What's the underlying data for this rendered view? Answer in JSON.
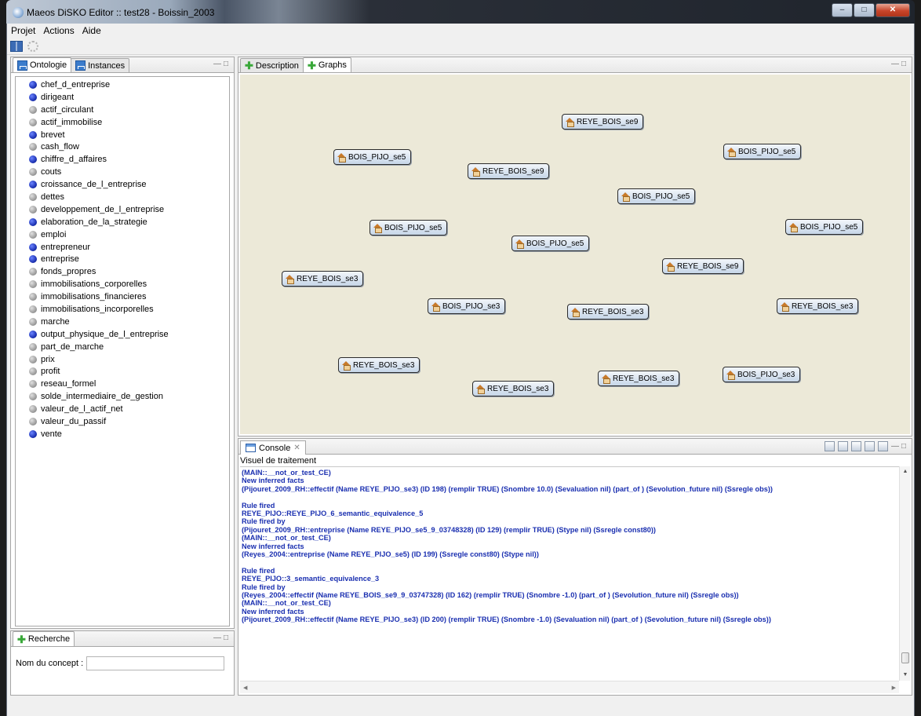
{
  "window": {
    "title": "Maeos DiSKO Editor :: test28 - Boissin_2003",
    "controls": [
      "minimize",
      "maximize",
      "close"
    ]
  },
  "menu": [
    "Projet",
    "Actions",
    "Aide"
  ],
  "toolbar": {
    "icons": [
      "book-icon",
      "spinner-icon"
    ]
  },
  "left_panel": {
    "tabs": [
      "Ontologie",
      "Instances"
    ],
    "concepts": [
      {
        "label": "chef_d_entreprise",
        "color": "blue"
      },
      {
        "label": "dirigeant",
        "color": "blue"
      },
      {
        "label": "actif_circulant",
        "color": "gray"
      },
      {
        "label": "actif_immobilise",
        "color": "gray"
      },
      {
        "label": "brevet",
        "color": "blue"
      },
      {
        "label": "cash_flow",
        "color": "gray"
      },
      {
        "label": "chiffre_d_affaires",
        "color": "blue"
      },
      {
        "label": "couts",
        "color": "gray"
      },
      {
        "label": "croissance_de_l_entreprise",
        "color": "blue"
      },
      {
        "label": "dettes",
        "color": "gray"
      },
      {
        "label": "developpement_de_l_entreprise",
        "color": "gray"
      },
      {
        "label": "elaboration_de_la_strategie",
        "color": "blue"
      },
      {
        "label": "emploi",
        "color": "gray"
      },
      {
        "label": "entrepreneur",
        "color": "blue"
      },
      {
        "label": "entreprise",
        "color": "blue"
      },
      {
        "label": "fonds_propres",
        "color": "gray"
      },
      {
        "label": "immobilisations_corporelles",
        "color": "gray"
      },
      {
        "label": "immobilisations_financieres",
        "color": "gray"
      },
      {
        "label": "immobilisations_incorporelles",
        "color": "gray"
      },
      {
        "label": "marche",
        "color": "gray"
      },
      {
        "label": "output_physique_de_l_entreprise",
        "color": "blue"
      },
      {
        "label": "part_de_marche",
        "color": "gray"
      },
      {
        "label": "prix",
        "color": "gray"
      },
      {
        "label": "profit",
        "color": "gray"
      },
      {
        "label": "reseau_formel",
        "color": "gray"
      },
      {
        "label": "solde_intermediaire_de_gestion",
        "color": "gray"
      },
      {
        "label": "valeur_de_l_actif_net",
        "color": "gray"
      },
      {
        "label": "valeur_du_passif",
        "color": "gray"
      },
      {
        "label": "vente",
        "color": "blue"
      }
    ]
  },
  "search_panel": {
    "tab": "Recherche",
    "label": "Nom du concept :",
    "value": ""
  },
  "graph_panel": {
    "tabs": [
      "Description",
      "Graphs"
    ],
    "nodes": [
      "REYE_BOIS_se9",
      "BOIS_PIJO_se5",
      "BOIS_PIJO_se5",
      "REYE_BOIS_se9",
      "BOIS_PIJO_se5",
      "BOIS_PIJO_se5",
      "BOIS_PIJO_se5",
      "BOIS_PIJO_se5",
      "REYE_BOIS_se9",
      "REYE_BOIS_se3",
      "BOIS_PIJO_se3",
      "REYE_BOIS_se3",
      "REYE_BOIS_se3",
      "REYE_BOIS_se3",
      "BOIS_PIJO_se3",
      "REYE_BOIS_se3",
      "REYE_BOIS_se3"
    ]
  },
  "console": {
    "tab": "Console",
    "subtitle": "Visuel de traitement",
    "lines": [
      "(MAIN::__not_or_test_CE)",
      "New inferred facts",
      "(Pijouret_2009_RH::effectif (Name REYE_PIJO_se3) (ID 198) (remplir TRUE) (Snombre 10.0) (Sevaluation nil) (part_of ) (Sevolution_future nil) (Ssregle obs))",
      "",
      "Rule fired",
      "REYE_PIJO::REYE_PIJO_6_semantic_equivalence_5",
      "Rule fired by",
      "(Pijouret_2009_RH::entreprise (Name REYE_PIJO_se5_9_03748328) (ID 129) (remplir TRUE) (Stype nil) (Ssregle const80))",
      "(MAIN::__not_or_test_CE)",
      "New inferred facts",
      "(Reyes_2004::entreprise (Name REYE_PIJO_se5) (ID 199) (Ssregle const80) (Stype nil))",
      "",
      "Rule fired",
      "REYE_PIJO::3_semantic_equivalence_3",
      "Rule fired by",
      "(Reyes_2004::effectif (Name REYE_BOIS_se9_9_03747328) (ID 162) (remplir TRUE) (Snombre -1.0) (part_of ) (Sevolution_future nil) (Ssregle obs))",
      "(MAIN::__not_or_test_CE)",
      "New inferred facts",
      "(Pijouret_2009_RH::effectif (Name REYE_PIJO_se3) (ID 200) (remplir TRUE) (Snombre -1.0) (Sevaluation nil) (part_of ) (Sevolution_future nil) (Ssregle obs))"
    ]
  }
}
